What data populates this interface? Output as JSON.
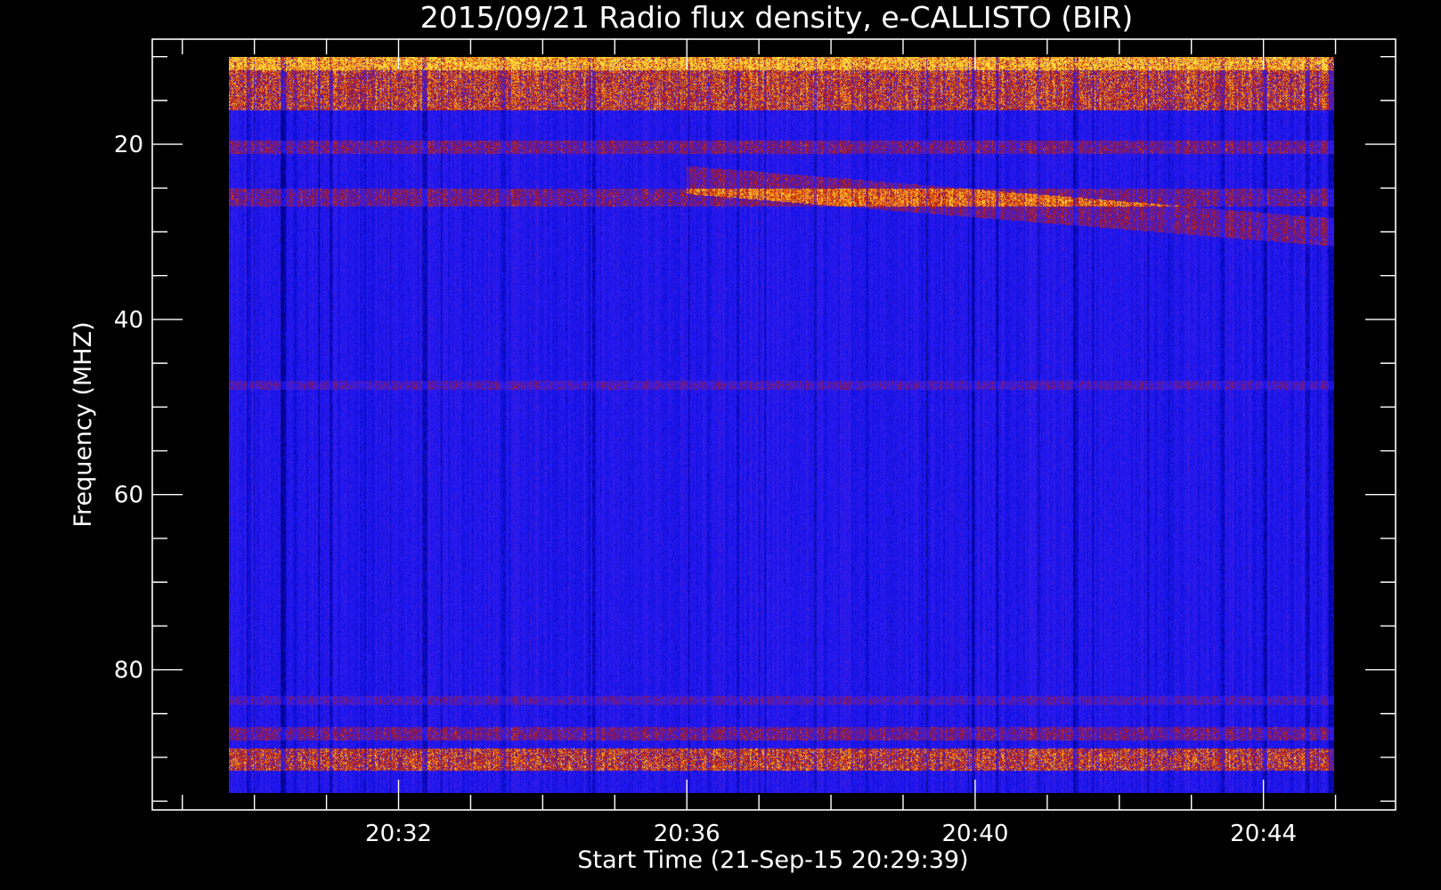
{
  "chart_data": {
    "type": "heatmap",
    "title": "2015/09/21  Radio flux density, e-CALLISTO (BIR)",
    "xlabel": "Start Time (21-Sep-15 20:29:39)",
    "ylabel": "Frequency (MHZ)",
    "x_axis": {
      "kind": "time",
      "data_start": "20:29:39",
      "data_end": "20:44:59",
      "range": [
        "20:28:35",
        "20:45:50"
      ],
      "major_ticks": [
        "20:32",
        "20:36",
        "20:40",
        "20:44"
      ],
      "minor_tick_interval_minutes": 1
    },
    "y_axis": {
      "data_range": [
        10,
        94
      ],
      "range": [
        8,
        96
      ],
      "inverted": true,
      "major_ticks": [
        20,
        40,
        60,
        80
      ],
      "minor_tick_interval": 5
    },
    "colormap": {
      "name": "blue-red-yellow",
      "stops": [
        "#000000",
        "#00008c",
        "#1414f0",
        "#3c1eea",
        "#7a1660",
        "#c8200a",
        "#ff7a00",
        "#ffe040"
      ]
    },
    "features": [
      {
        "type": "band",
        "freq_range": [
          10,
          16
        ],
        "intensity": "high"
      },
      {
        "type": "band",
        "freq_range": [
          19.5,
          21
        ],
        "intensity": "medium"
      },
      {
        "type": "band",
        "freq_range": [
          25,
          27
        ],
        "intensity": "medium"
      },
      {
        "type": "band",
        "freq_range": [
          47,
          48
        ],
        "intensity": "low"
      },
      {
        "type": "band",
        "freq_range": [
          83,
          84
        ],
        "intensity": "low"
      },
      {
        "type": "band",
        "freq_range": [
          86.5,
          88
        ],
        "intensity": "medium"
      },
      {
        "type": "band",
        "freq_range": [
          89,
          91.5
        ],
        "intensity": "high"
      },
      {
        "type": "drift",
        "time_range": [
          "20:36:00",
          "20:44:59"
        ],
        "freq_range": [
          24,
          30
        ],
        "intensity": "medium"
      }
    ]
  }
}
